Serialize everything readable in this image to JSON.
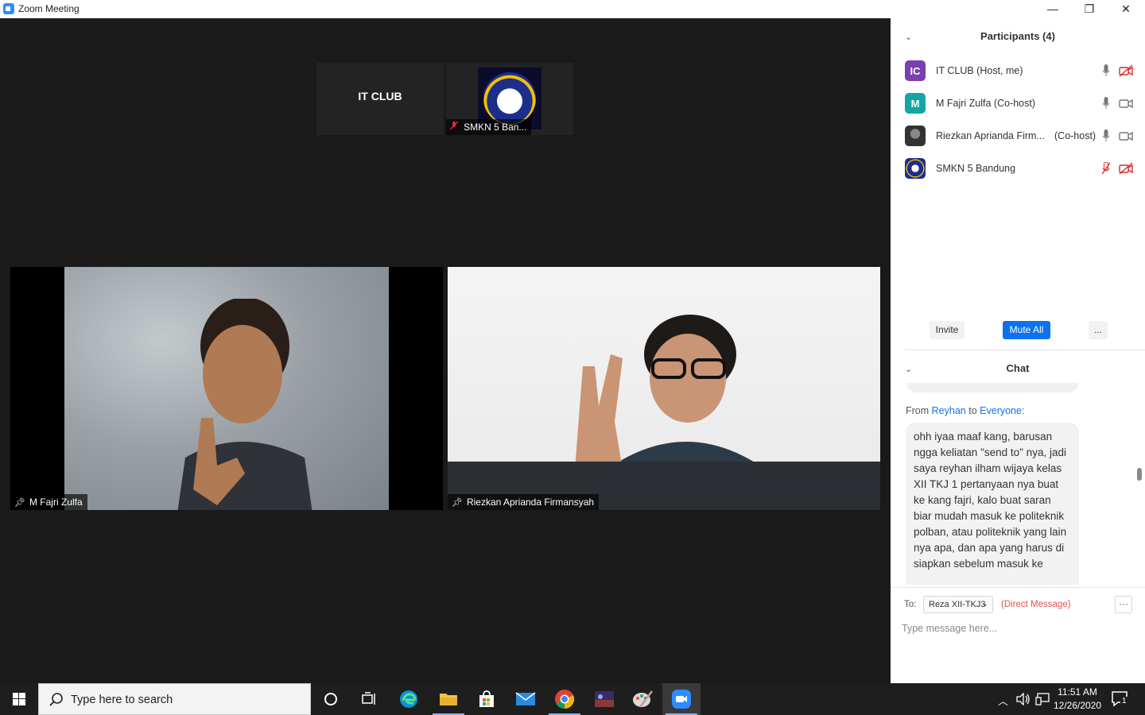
{
  "window": {
    "title": "Zoom Meeting",
    "minimize": "—",
    "maximize": "❐",
    "close": "✕"
  },
  "thumbnails": [
    {
      "name": "IT CLUB"
    },
    {
      "name": "SMKN 5 Ban..."
    }
  ],
  "videos": [
    {
      "name": "M Fajri Zulfa"
    },
    {
      "name": "Riezkan Aprianda Firmansyah"
    }
  ],
  "participants": {
    "title": "Participants (4)",
    "list": [
      {
        "initials": "IC",
        "name": "IT CLUB (Host, me)",
        "tag": "",
        "color": "#7a3fb0",
        "mic": "on",
        "video": "off"
      },
      {
        "initials": "M",
        "name": "M Fajri Zulfa (Co-host)",
        "tag": "",
        "color": "#16a5a5",
        "mic": "on",
        "video": "on"
      },
      {
        "initials": "",
        "name": "Riezkan Aprianda Firm...",
        "tag": "(Co-host)",
        "color": "#444444",
        "mic": "on",
        "video": "on"
      },
      {
        "initials": "",
        "name": "SMKN 5 Bandung",
        "tag": "",
        "color": "#1c2e8c",
        "mic": "muted",
        "video": "off"
      }
    ],
    "invite": "Invite",
    "mute_all": "Mute All",
    "more": "..."
  },
  "chat": {
    "title": "Chat",
    "from_label": "From",
    "sender": "Reyhan",
    "to_label": "to",
    "recipient": "Everyone:",
    "message": "ohh iyaa maaf kang, barusan ngga keliatan \"send to\" nya, jadi saya reyhan ilham wijaya kelas XII TKJ 1 pertanyaan nya buat ke kang fajri, kalo buat saran biar mudah masuk ke politeknik polban, atau politeknik yang lain nya apa, dan apa yang harus di siapkan sebelum masuk ke",
    "to": "To:",
    "selected_recipient": "Reza XII-TKJ3",
    "direct_message": "(Direct Message)",
    "more": "···",
    "placeholder": "Type message here..."
  },
  "taskbar": {
    "search_placeholder": "Type here to search",
    "time": "11:51 AM",
    "date": "12/26/2020",
    "notification_count": "1"
  },
  "colors": {
    "accent": "#0e72ed",
    "muted_red": "#e02828",
    "video_bg": "#1a1a1a"
  }
}
